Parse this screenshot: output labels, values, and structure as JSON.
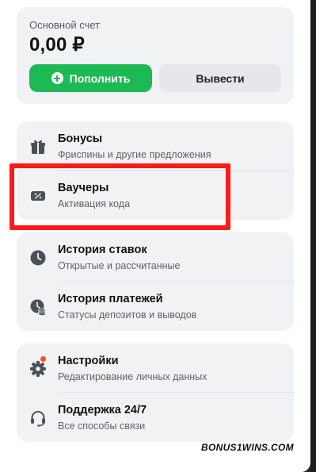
{
  "balance": {
    "label": "Основной счет",
    "amount": "0,00 ₽",
    "deposit_label": "Пополнить",
    "withdraw_label": "Вывести"
  },
  "menu": {
    "bonuses": {
      "title": "Бонусы",
      "subtitle": "Фриспины и другие предложения",
      "icon": "gift-icon"
    },
    "vouchers": {
      "title": "Ваучеры",
      "subtitle": "Активация кода",
      "icon": "voucher-icon"
    },
    "bet_history": {
      "title": "История ставок",
      "subtitle": "Открытые и рассчитанные",
      "icon": "clock-icon"
    },
    "payment_history": {
      "title": "История платежей",
      "subtitle": "Статусы депозитов и выводов",
      "icon": "payment-history-icon"
    },
    "settings": {
      "title": "Настройки",
      "subtitle": "Редактирование личных данных",
      "icon": "gear-icon"
    },
    "support": {
      "title": "Поддержка 24/7",
      "subtitle": "Все способы связи",
      "icon": "headset-icon"
    }
  },
  "watermark": "BONUS1WINS.COM",
  "colors": {
    "accent": "#1db954",
    "highlight": "#ff1a1a",
    "notification": "#ff4d1a"
  }
}
